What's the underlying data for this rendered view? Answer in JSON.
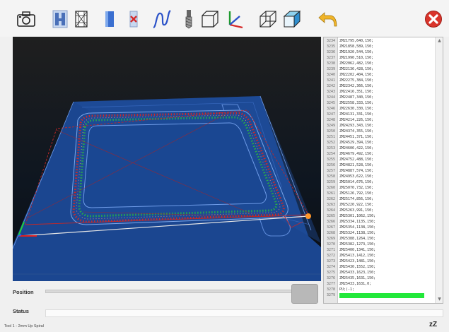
{
  "toolbar": {
    "icons": [
      "camera-icon",
      "view-side-icon",
      "view-wireframe-icon",
      "view-solid-icon",
      "hide-stock-icon",
      "toolpath-icon",
      "tool-icon",
      "box-view-icon",
      "axes-icon",
      "iso-wireframe-icon",
      "iso-solid-icon",
      "undo-arrow-icon",
      "close-icon"
    ],
    "accent": "#1f4a9e",
    "close_color": "#d9342b",
    "undo_color": "#e8b020"
  },
  "viewport": {
    "background": "#111418",
    "stock_color": "#1f4a9e",
    "toolpath_colors": [
      "#cc2a2a",
      "#2aa84a"
    ]
  },
  "code": {
    "lines": [
      {
        "n": "3234",
        "t": "ZM21795,640,150;"
      },
      {
        "n": "3235",
        "t": "ZM21858,589,150;"
      },
      {
        "n": "3236",
        "t": "ZM21920,544,150;"
      },
      {
        "n": "3237",
        "t": "ZM21990,510,150;"
      },
      {
        "n": "3238",
        "t": "ZM22062,482,150;"
      },
      {
        "n": "3239",
        "t": "ZM22136,428,150;"
      },
      {
        "n": "3240",
        "t": "ZM22202,404,150;"
      },
      {
        "n": "3241",
        "t": "ZM22275,384,150;"
      },
      {
        "n": "3242",
        "t": "ZM22342,366,150;"
      },
      {
        "n": "3243",
        "t": "ZM22416,351,150;"
      },
      {
        "n": "3244",
        "t": "ZM22487,340,150;"
      },
      {
        "n": "3245",
        "t": "ZM22558,333,150;"
      },
      {
        "n": "3246",
        "t": "ZM22630,330,150;"
      },
      {
        "n": "3247",
        "t": "ZM24131,331,150;"
      },
      {
        "n": "3248",
        "t": "ZM24214,226,150;"
      },
      {
        "n": "3249",
        "t": "ZM24293,343,150;"
      },
      {
        "n": "3250",
        "t": "ZM24374,355,150;"
      },
      {
        "n": "3251",
        "t": "ZM24451,371,150;"
      },
      {
        "n": "3252",
        "t": "ZM24529,394,150;"
      },
      {
        "n": "3253",
        "t": "ZM24606,422,150;"
      },
      {
        "n": "3254",
        "t": "ZM24679,492,150;"
      },
      {
        "n": "3255",
        "t": "ZM24752,488,150;"
      },
      {
        "n": "3256",
        "t": "ZM24821,528,150;"
      },
      {
        "n": "3257",
        "t": "ZM24887,574,150;"
      },
      {
        "n": "3258",
        "t": "ZM24953,622,150;"
      },
      {
        "n": "3259",
        "t": "ZM25014,676,150;"
      },
      {
        "n": "3260",
        "t": "ZM25070,732,150;"
      },
      {
        "n": "3261",
        "t": "ZM25126,792,150;"
      },
      {
        "n": "3262",
        "t": "ZM25174,856,150;"
      },
      {
        "n": "3263",
        "t": "ZM25220,922,150;"
      },
      {
        "n": "3264",
        "t": "ZM25263,991,150;"
      },
      {
        "n": "3265",
        "t": "ZM25301,1062,150;"
      },
      {
        "n": "3266",
        "t": "ZM25334,1135,150;"
      },
      {
        "n": "3267",
        "t": "ZM25354,1138,150;"
      },
      {
        "n": "3268",
        "t": "ZM25324,1138,150;"
      },
      {
        "n": "3269",
        "t": "ZM25388,1264,150;"
      },
      {
        "n": "3270",
        "t": "ZM25382,1273,150;"
      },
      {
        "n": "3271",
        "t": "ZM25400,1341,150;"
      },
      {
        "n": "3272",
        "t": "ZM25413,1412,150;"
      },
      {
        "n": "3273",
        "t": "ZM25423,1481,150;"
      },
      {
        "n": "3274",
        "t": "ZM25430,1552,150;"
      },
      {
        "n": "3275",
        "t": "ZM25433,1623,150;"
      },
      {
        "n": "3276",
        "t": "ZM25435,1631,150;"
      },
      {
        "n": "3277",
        "t": "ZM25433,1631,0;"
      },
      {
        "n": "3278",
        "t": "PU;(-1;"
      },
      {
        "n": "3279",
        "t": ""
      }
    ],
    "active_line": "3279",
    "active_color": "#22e83a"
  },
  "position": {
    "label": "Position",
    "value": 1.0
  },
  "status": {
    "label": "Status",
    "value": ""
  },
  "footer": {
    "tool_info": "Tool 1 - 2mm Up Spiral",
    "sleep_icon": "zZ"
  }
}
